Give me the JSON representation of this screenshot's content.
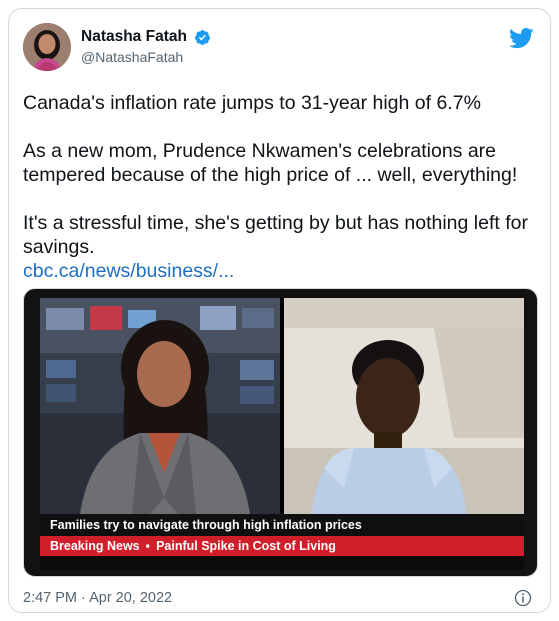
{
  "tweet": {
    "author": {
      "display_name": "Natasha Fatah",
      "handle": "@NatashaFatah",
      "verified": true
    },
    "paragraphs": [
      "Canada's inflation rate jumps to 31-year high of 6.7%",
      "As a new mom, Prudence Nkwamen's celebrations are tempered because of the high price of ... well, everything!",
      "It's a stressful time, she's getting by but has nothing left for savings."
    ],
    "link_text": "cbc.ca/news/business/...",
    "media": {
      "caption": "Families try to navigate through high inflation prices",
      "ticker_label": "Breaking News",
      "ticker_separator": "▪",
      "ticker_headline": "Painful Spike in Cost of Living"
    },
    "timestamp": "2:47 PM · Apr 20, 2022"
  },
  "icons": {
    "verified": "verified-badge-icon",
    "brand": "twitter-bird-icon",
    "info": "info-icon"
  },
  "colors": {
    "verified_blue": "#1d9bf0",
    "link_blue": "#1d6fc4",
    "ticker_red": "#d01f2a",
    "secondary_text": "#536471"
  }
}
